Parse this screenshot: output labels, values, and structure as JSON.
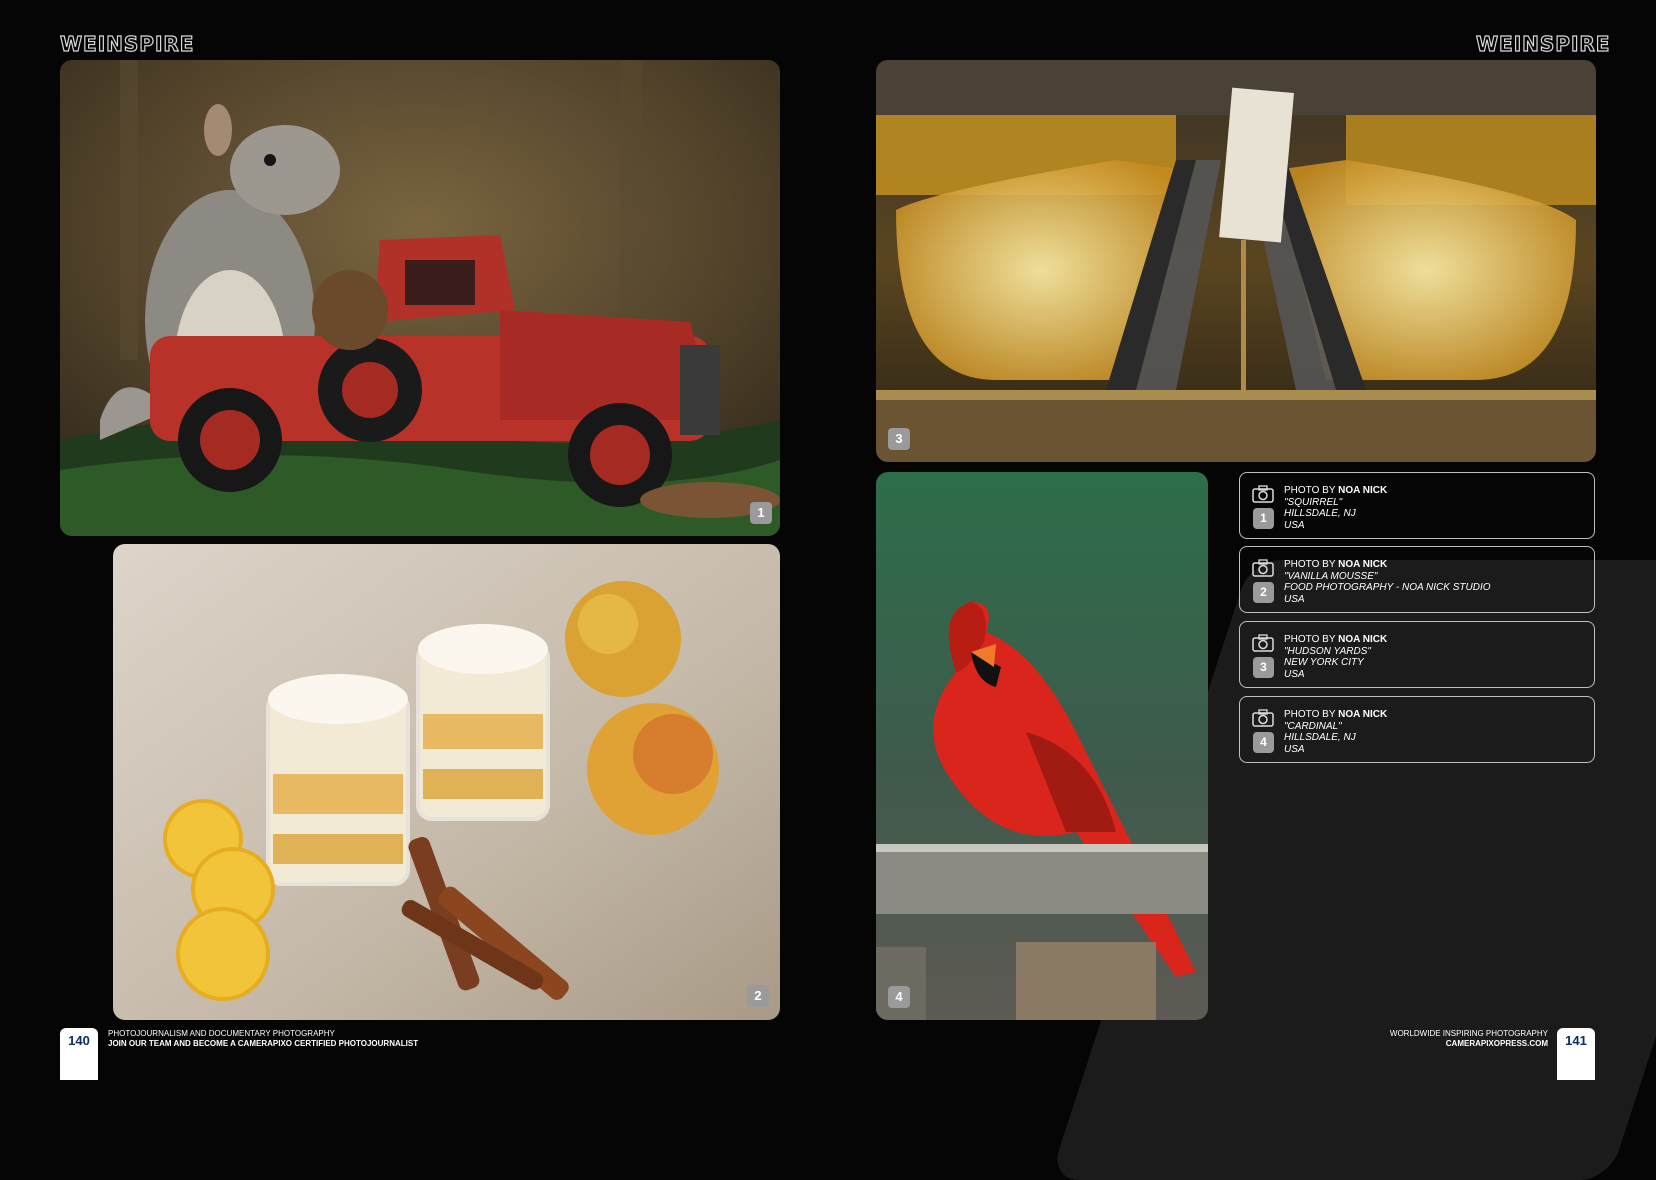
{
  "brand": "WEINSPIRE",
  "photos": [
    {
      "number": "1",
      "by_prefix": "PHOTO BY",
      "photographer": "NOA NICK",
      "title": "\"SQUIRREL\"",
      "location": "HILLSDALE, NJ",
      "country": "USA"
    },
    {
      "number": "2",
      "by_prefix": "PHOTO BY",
      "photographer": "NOA NICK",
      "title": "\"VANILLA MOUSSE\"",
      "location": "FOOD PHOTOGRAPHY - NOA NICK STUDIO",
      "country": "USA"
    },
    {
      "number": "3",
      "by_prefix": "PHOTO BY",
      "photographer": "NOA NICK",
      "title": "\"HUDSON YARDS\"",
      "location": "NEW YORK CITY",
      "country": "USA"
    },
    {
      "number": "4",
      "by_prefix": "PHOTO BY",
      "photographer": "NOA NICK",
      "title": "\"CARDINAL\"",
      "location": "HILLSDALE, NJ",
      "country": "USA"
    }
  ],
  "footer": {
    "left_page": "140",
    "left_line1": "PHOTOJOURNALISM AND DOCUMENTARY PHOTOGRAPHY",
    "left_line2": "JOIN OUR TEAM AND BECOME A CAMERAPIXO CERTIFIED PHOTOJOURNALIST",
    "right_page": "141",
    "right_line1": "WORLDWIDE INSPIRING PHOTOGRAPHY",
    "right_line2": "CAMERAPIXOPRESS.COM"
  },
  "icons": {
    "camera": "camera-icon"
  }
}
